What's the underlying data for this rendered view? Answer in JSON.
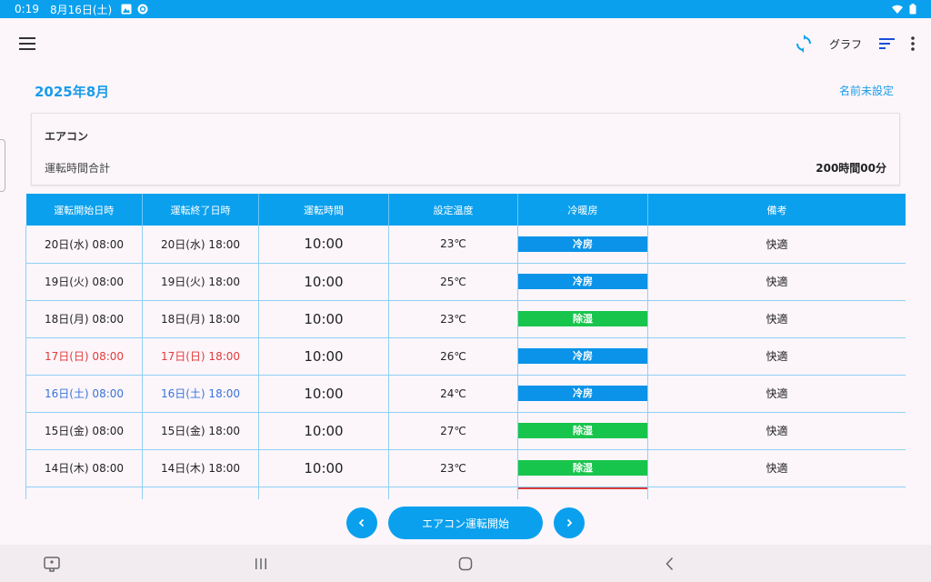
{
  "status_bar": {
    "time": "0:19",
    "date": "8月16日(土)"
  },
  "toolbar": {
    "graph_label": "グラフ"
  },
  "header": {
    "month": "2025年8月",
    "name_link": "名前未設定"
  },
  "summary": {
    "device": "エアコン",
    "total_label": "運転時間合計",
    "total_value": "200時間00分"
  },
  "table": {
    "headers": [
      "運転開始日時",
      "運転終了日時",
      "運転時間",
      "設定温度",
      "冷暖房",
      "備考"
    ],
    "rows": [
      {
        "start": "20日(水) 08:00",
        "end": "20日(水) 18:00",
        "duration": "10:00",
        "temp": "23℃",
        "mode": "冷房",
        "note": "快適",
        "day": "weekday"
      },
      {
        "start": "19日(火) 08:00",
        "end": "19日(火) 18:00",
        "duration": "10:00",
        "temp": "25℃",
        "mode": "冷房",
        "note": "快適",
        "day": "weekday"
      },
      {
        "start": "18日(月) 08:00",
        "end": "18日(月) 18:00",
        "duration": "10:00",
        "temp": "23℃",
        "mode": "除湿",
        "note": "快適",
        "day": "weekday"
      },
      {
        "start": "17日(日) 08:00",
        "end": "17日(日) 18:00",
        "duration": "10:00",
        "temp": "26℃",
        "mode": "冷房",
        "note": "快適",
        "day": "sun"
      },
      {
        "start": "16日(土) 08:00",
        "end": "16日(土) 18:00",
        "duration": "10:00",
        "temp": "24℃",
        "mode": "冷房",
        "note": "快適",
        "day": "sat"
      },
      {
        "start": "15日(金) 08:00",
        "end": "15日(金) 18:00",
        "duration": "10:00",
        "temp": "27℃",
        "mode": "除湿",
        "note": "快適",
        "day": "weekday"
      },
      {
        "start": "14日(木) 08:00",
        "end": "14日(木) 18:00",
        "duration": "10:00",
        "temp": "23℃",
        "mode": "除湿",
        "note": "快適",
        "day": "weekday"
      }
    ]
  },
  "mode_colors": {
    "冷房": "#0a93e8",
    "除湿": "#18c54c"
  },
  "bottom": {
    "start_label": "エアコン運転開始"
  },
  "colors": {
    "accent": "#0aa0ee",
    "sunday": "#e23b3b",
    "saturday": "#3a73d9"
  }
}
